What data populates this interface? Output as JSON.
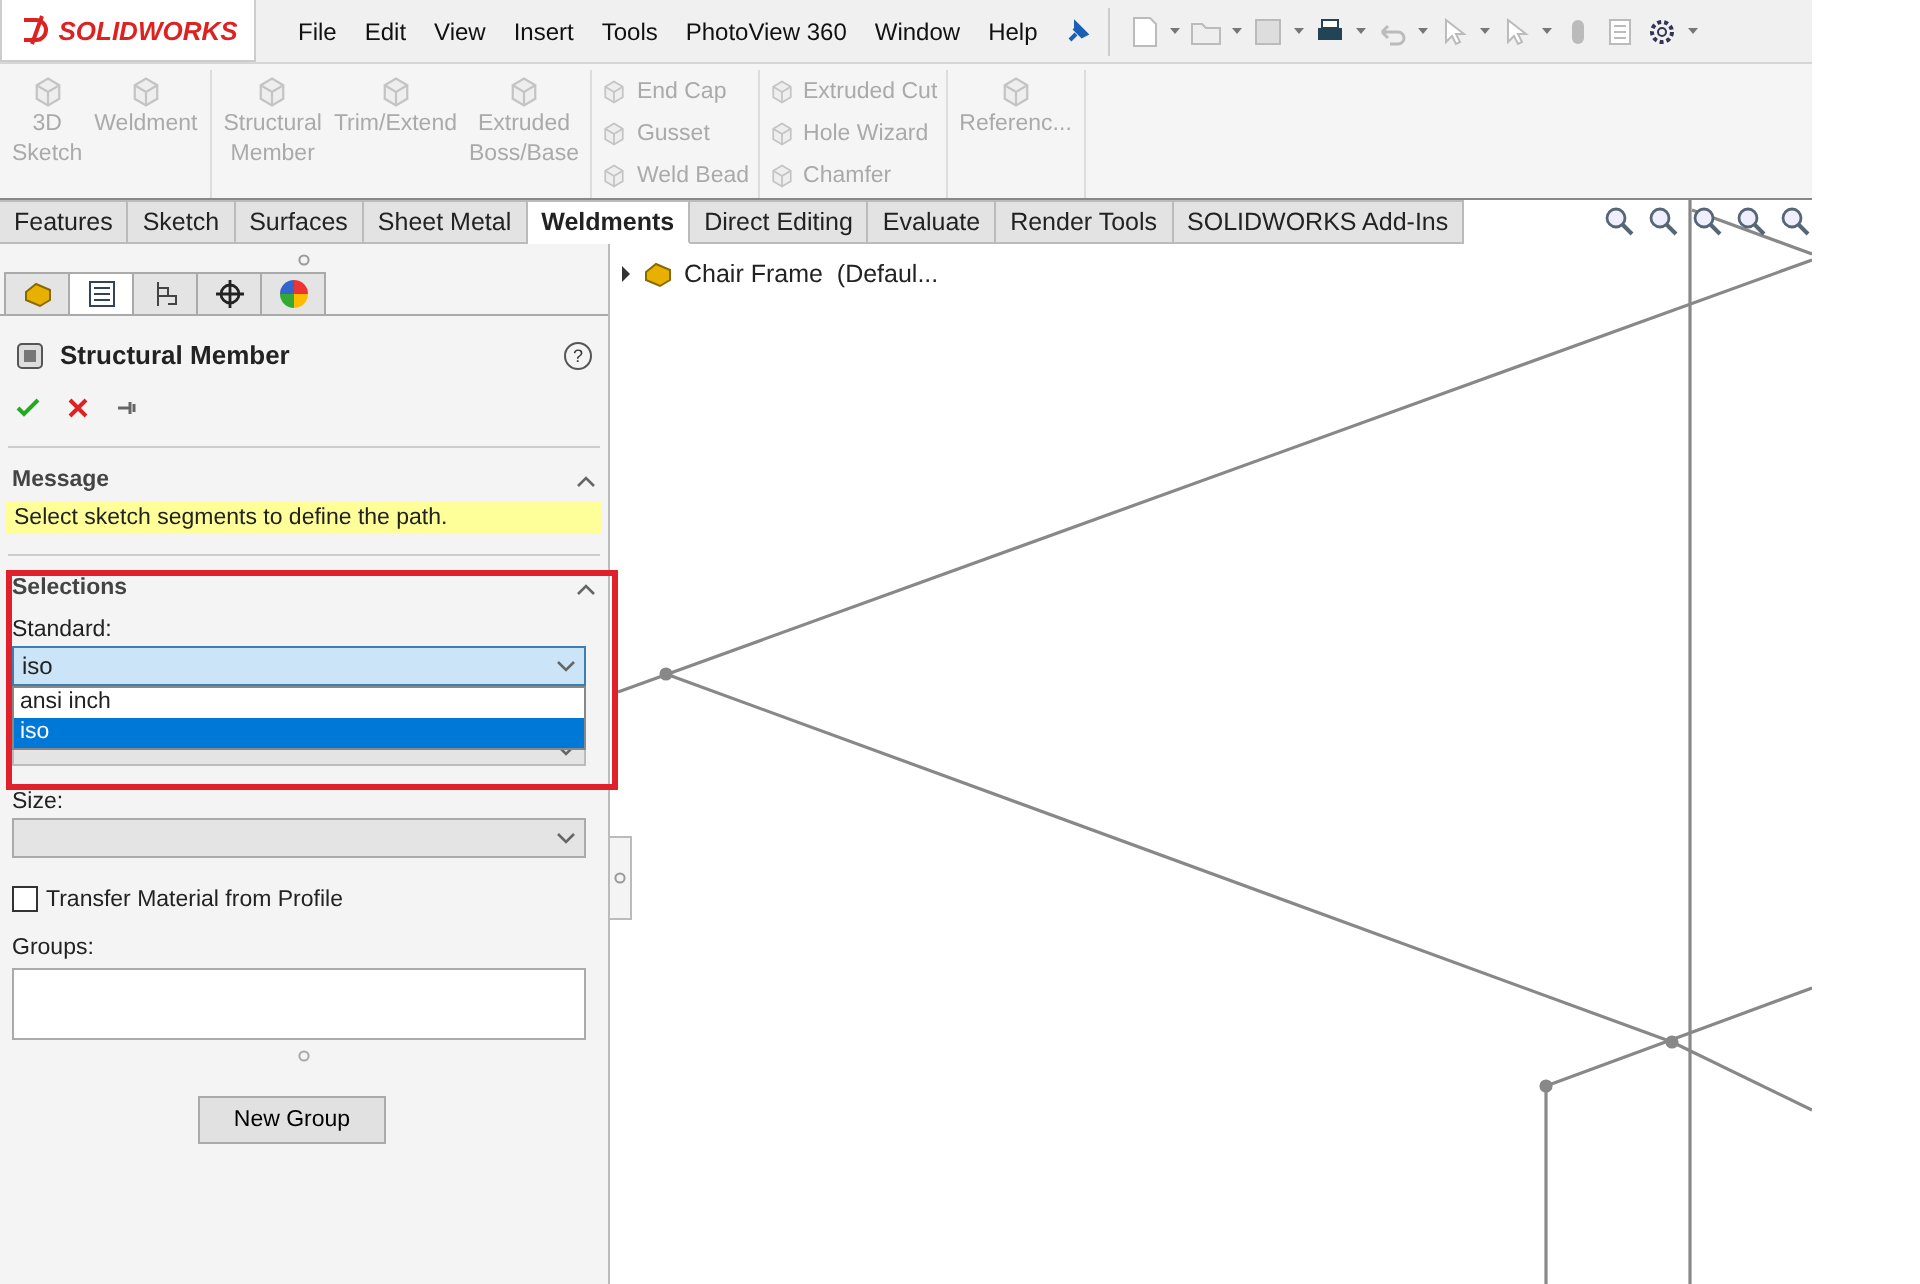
{
  "app": {
    "logo": "SOLIDWORKS"
  },
  "menu": [
    "File",
    "Edit",
    "View",
    "Insert",
    "Tools",
    "PhotoView 360",
    "Window",
    "Help"
  ],
  "ribbon": {
    "groups": [
      {
        "kind": "large",
        "items": [
          {
            "label": "3D Sketch",
            "disabled": true
          },
          {
            "label": "Weldment",
            "disabled": true
          }
        ]
      },
      {
        "kind": "large",
        "items": [
          {
            "label": "Structural Member",
            "disabled": true
          },
          {
            "label": "Trim/Extend",
            "disabled": true
          },
          {
            "label": "Extruded Boss/Base",
            "disabled": true
          }
        ]
      },
      {
        "kind": "small",
        "items": [
          {
            "label": "End Cap",
            "disabled": true
          },
          {
            "label": "Gusset",
            "disabled": true
          },
          {
            "label": "Weld Bead",
            "disabled": true
          }
        ]
      },
      {
        "kind": "small",
        "items": [
          {
            "label": "Extruded Cut",
            "disabled": true
          },
          {
            "label": "Hole Wizard",
            "disabled": true
          },
          {
            "label": "Chamfer",
            "disabled": true
          }
        ]
      },
      {
        "kind": "large",
        "items": [
          {
            "label": "Referenc...",
            "disabled": true
          }
        ]
      }
    ]
  },
  "tabs": [
    {
      "label": "Features",
      "selected": false
    },
    {
      "label": "Sketch",
      "selected": false
    },
    {
      "label": "Surfaces",
      "selected": false
    },
    {
      "label": "Sheet Metal",
      "selected": false
    },
    {
      "label": "Weldments",
      "selected": true
    },
    {
      "label": "Direct Editing",
      "selected": false
    },
    {
      "label": "Evaluate",
      "selected": false
    },
    {
      "label": "Render Tools",
      "selected": false
    },
    {
      "label": "SOLIDWORKS Add-Ins",
      "selected": false
    }
  ],
  "panel_tabs": [
    {
      "selected": false
    },
    {
      "selected": true
    },
    {
      "selected": false
    },
    {
      "selected": false
    },
    {
      "selected": false
    }
  ],
  "property_manager": {
    "title": "Structural Member",
    "help": "?",
    "sections": [
      {
        "title": "Message",
        "expanded": true
      },
      {
        "title": "Selections",
        "expanded": true
      }
    ],
    "message": "Select sketch segments to define the path.",
    "standard": {
      "label": "Standard:",
      "value": "iso",
      "options": [
        {
          "label": "ansi inch",
          "selected": false
        },
        {
          "label": "iso",
          "selected": true
        }
      ]
    },
    "size": {
      "label": "Size:"
    },
    "transfer_material": {
      "label": "Transfer Material from Profile",
      "checked": false
    },
    "groups": {
      "label": "Groups:"
    },
    "new_group_button": "New Group"
  },
  "tree": {
    "label": "Chair Frame  (Defaul...",
    "expanded": false
  }
}
